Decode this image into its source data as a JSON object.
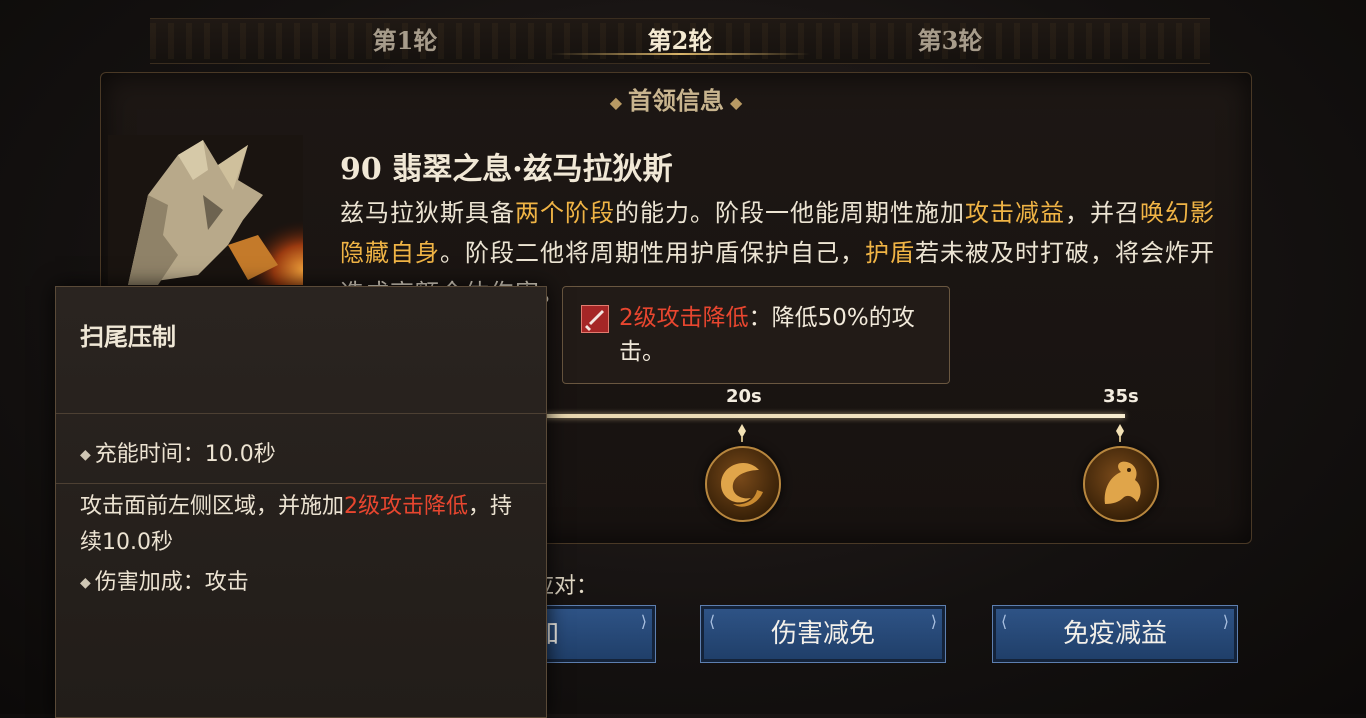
{
  "tabs": [
    {
      "label": "第1轮",
      "active": false
    },
    {
      "label": "第2轮",
      "active": true
    },
    {
      "label": "第3轮",
      "active": false
    }
  ],
  "panel": {
    "title": "首领信息",
    "boss_name": "90 翡翠之息·兹马拉狄斯",
    "desc": {
      "p1": "兹马拉狄斯具备",
      "h1": "两个阶段",
      "p2": "的能力。阶段一他能周期性施加",
      "h2": "攻击减益",
      "p3": "，并召",
      "h3": "唤幻影隐藏自身",
      "p4": "。阶段二他将周期性用护盾保护自己，",
      "h4": "护盾",
      "p5": "若未被及时打破，将会炸开造成高额全体伤害。"
    }
  },
  "timeline": {
    "ticks": [
      {
        "label": "20s"
      },
      {
        "label": "35s"
      }
    ]
  },
  "counter": {
    "label": "应对：",
    "buttons": [
      {
        "label": "增加"
      },
      {
        "label": "伤害减免"
      },
      {
        "label": "免疫减益"
      }
    ]
  },
  "debuff_tooltip": {
    "name": "2级攻击降低",
    "text": "：降低50%的攻击。"
  },
  "skill_tooltip": {
    "title": "扫尾压制",
    "charge": "充能时间：10.0秒",
    "effect_pre": "攻击面前左侧区域，并施加",
    "effect_hl": "2级攻击降低",
    "effect_post": "，持续10.0秒",
    "bonus": "伤害加成：攻击"
  },
  "colors": {
    "highlight": "#f0b445",
    "debuff_red": "#e8462f",
    "button_blue": "#2f5487"
  }
}
